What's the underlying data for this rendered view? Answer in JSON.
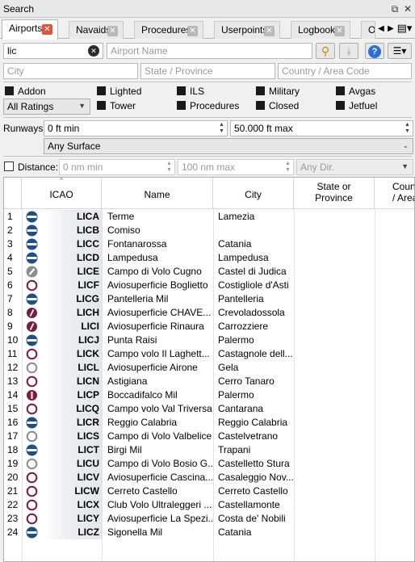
{
  "window": {
    "title": "Search"
  },
  "tabs": [
    {
      "label": "Airports",
      "active": true
    },
    {
      "label": "Navaids",
      "active": false
    },
    {
      "label": "Procedures",
      "active": false
    },
    {
      "label": "Userpoints",
      "active": false
    },
    {
      "label": "Logbook",
      "active": false
    },
    {
      "label": "O",
      "active": false
    }
  ],
  "search": {
    "ident_value": "lic",
    "name_placeholder": "Airport Name",
    "city_placeholder": "City",
    "state_placeholder": "State / Province",
    "country_placeholder": "Country / Area Code"
  },
  "filters": {
    "col1": [
      {
        "label": "Addon",
        "checked": true
      }
    ],
    "ratings": "All Ratings",
    "col2": [
      {
        "label": "Lighted",
        "checked": true
      },
      {
        "label": "Tower",
        "checked": true
      }
    ],
    "col3": [
      {
        "label": "ILS",
        "checked": true
      },
      {
        "label": "Procedures",
        "checked": true
      }
    ],
    "col4": [
      {
        "label": "Military",
        "checked": true
      },
      {
        "label": "Closed",
        "checked": true
      }
    ],
    "col5": [
      {
        "label": "Avgas",
        "checked": true
      },
      {
        "label": "Jetfuel",
        "checked": true
      }
    ]
  },
  "runways": {
    "label": "Runways:",
    "min": "0 ft min",
    "max": "50.000 ft max",
    "surface": "Any Surface"
  },
  "distance": {
    "label": "Distance:",
    "min": "0 nm min",
    "max": "100 nm max",
    "dir": "Any Dir."
  },
  "table": {
    "columns": [
      "ICAO",
      "Name",
      "City",
      "State or Province",
      "Country / Area"
    ],
    "rows": [
      {
        "n": "1",
        "icao": "LICA",
        "name": "Terme",
        "city": "Lamezia",
        "icon": "blue-runway"
      },
      {
        "n": "2",
        "icao": "LICB",
        "name": "Comiso",
        "city": "",
        "icon": "blue-runway"
      },
      {
        "n": "3",
        "icao": "LICC",
        "name": "Fontanarossa",
        "city": "Catania",
        "icon": "blue-runway"
      },
      {
        "n": "4",
        "icao": "LICD",
        "name": "Lampedusa",
        "city": "Lampedusa",
        "icon": "blue-runway"
      },
      {
        "n": "5",
        "icao": "LICE",
        "name": "Campo di Volo Cugno",
        "city": "Castel di Judica",
        "icon": "gray-slash"
      },
      {
        "n": "6",
        "icao": "LICF",
        "name": "Aviosuperficie Boglietto",
        "city": "Costigliole d'Asti",
        "icon": "ring"
      },
      {
        "n": "7",
        "icao": "LICG",
        "name": "Pantelleria Mil",
        "city": "Pantelleria",
        "icon": "blue-runway"
      },
      {
        "n": "8",
        "icao": "LICH",
        "name": "Aviosuperficie CHAVE...",
        "city": "Crevoladossola",
        "icon": "ring-slash"
      },
      {
        "n": "9",
        "icao": "LICI",
        "name": "Aviosuperficie Rinaura",
        "city": "Carrozziere",
        "icon": "ring-slash"
      },
      {
        "n": "10",
        "icao": "LICJ",
        "name": "Punta Raisi",
        "city": "Palermo",
        "icon": "blue-runway"
      },
      {
        "n": "11",
        "icao": "LICK",
        "name": "Campo volo Il Laghett...",
        "city": "Castagnole dell...",
        "icon": "ring"
      },
      {
        "n": "12",
        "icao": "LICL",
        "name": "Aviosuperficie Airone",
        "city": "Gela",
        "icon": "gray-ring"
      },
      {
        "n": "13",
        "icao": "LICN",
        "name": "Astigiana",
        "city": "Cerro Tanaro",
        "icon": "ring"
      },
      {
        "n": "14",
        "icao": "LICP",
        "name": "Boccadifalco Mil",
        "city": "Palermo",
        "icon": "ring-bar"
      },
      {
        "n": "15",
        "icao": "LICQ",
        "name": "Campo volo Val Triversa",
        "city": "Cantarana",
        "icon": "ring"
      },
      {
        "n": "16",
        "icao": "LICR",
        "name": "Reggio Calabria",
        "city": "Reggio Calabria",
        "icon": "blue-runway"
      },
      {
        "n": "17",
        "icao": "LICS",
        "name": "Campo di Volo Valbelice",
        "city": "Castelvetrano",
        "icon": "gray-ring"
      },
      {
        "n": "18",
        "icao": "LICT",
        "name": "Birgi Mil",
        "city": "Trapani",
        "icon": "blue-runway"
      },
      {
        "n": "19",
        "icao": "LICU",
        "name": "Campo di Volo Bosio G...",
        "city": "Castelletto Stura",
        "icon": "gray-ring"
      },
      {
        "n": "20",
        "icao": "LICV",
        "name": "Aviosuperficie Cascina...",
        "city": "Casaleggio Nov...",
        "icon": "ring"
      },
      {
        "n": "21",
        "icao": "LICW",
        "name": "Cerreto Castello",
        "city": "Cerreto Castello",
        "icon": "ring"
      },
      {
        "n": "22",
        "icao": "LICX",
        "name": "Club Volo Ultraleggeri ...",
        "city": "Castellamonte",
        "icon": "ring"
      },
      {
        "n": "23",
        "icao": "LICY",
        "name": "Aviosuperficie La Spezi...",
        "city": "Costa de' Nobili",
        "icon": "ring"
      },
      {
        "n": "24",
        "icao": "LICZ",
        "name": "Sigonella Mil",
        "city": "Catania",
        "icon": "blue-runway"
      }
    ]
  },
  "colors": {
    "airport_blue": "#1f4e8c",
    "airport_maroon": "#7b1c3e",
    "airport_gray": "#8c8c8c",
    "active_tab_close": "#e0553a"
  }
}
